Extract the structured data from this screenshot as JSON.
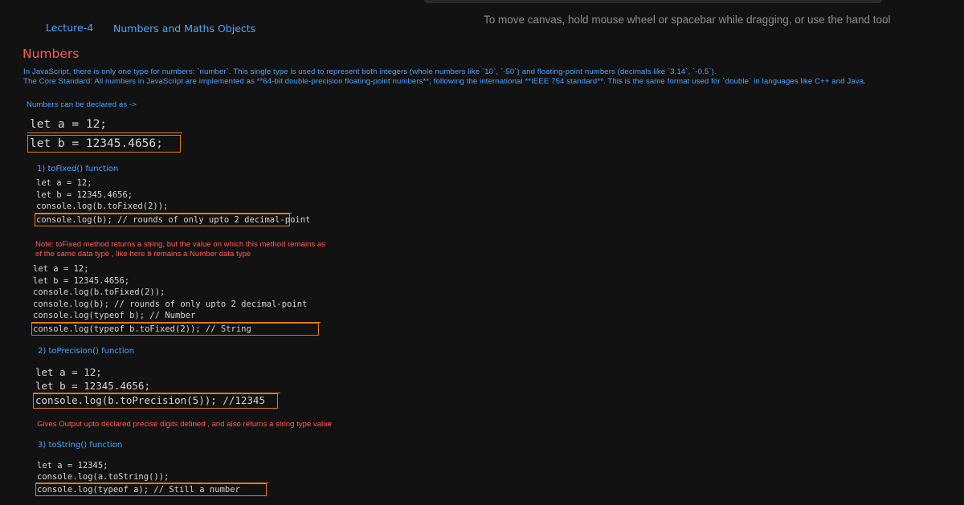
{
  "canvas": {
    "hint": "To move canvas, hold mouse wheel or spacebar while dragging, or use the hand tool"
  },
  "header": {
    "lecture": "Lecture-4",
    "title": "Numbers and Maths Objects"
  },
  "numbers": {
    "heading": "Numbers",
    "intro_line1": "In JavaScript, there is only one type for numbers: `number`. This single type is used to represent both integers (whole numbers like `10`, `-50`) and floating-point numbers (decimals like `3.14`, `-0.5`).",
    "intro_line2": "The Core Standard: All numbers in JavaScript are implemented as **64-bit double-precision floating-point numbers**, following the international **IEEE 754 standard**. This is the same format used for `double` in languages like C++ and Java.",
    "declared_note": "Numbers can be declared as ->"
  },
  "block1": {
    "line1": "let a = 12;",
    "line2": "let b = 12345.4656;"
  },
  "tofixed": {
    "heading": "1)  toFixed() function",
    "code": [
      "let a = 12;",
      "let b = 12345.4656;",
      "console.log(b.toFixed(2));",
      "console.log(b); // rounds of only upto 2 decimal-point"
    ],
    "note_line1": "Note: toFixed method returns a string, but the value on which this method remains as",
    "note_line2": "of the same data type , like here b remains a Number data type",
    "code2": [
      "let a = 12;",
      "let b = 12345.4656;",
      "console.log(b.toFixed(2));",
      "console.log(b); // rounds of only upto 2 decimal-point",
      "console.log(typeof b); // Number",
      "console.log(typeof b.toFixed(2)); // String"
    ]
  },
  "toprecision": {
    "heading": "2) toPrecision() function",
    "code": [
      "let a = 12;",
      "let b = 12345.4656;",
      "console.log(b.toPrecision(5)); //12345"
    ],
    "note": "Gives Output upto declared precise digits defined , and also returns a string type value"
  },
  "tostring": {
    "heading": "3) toString() function",
    "code": [
      "let a = 12345;",
      "console.log(a.toString());",
      "console.log(typeof a); // Still a number"
    ]
  }
}
